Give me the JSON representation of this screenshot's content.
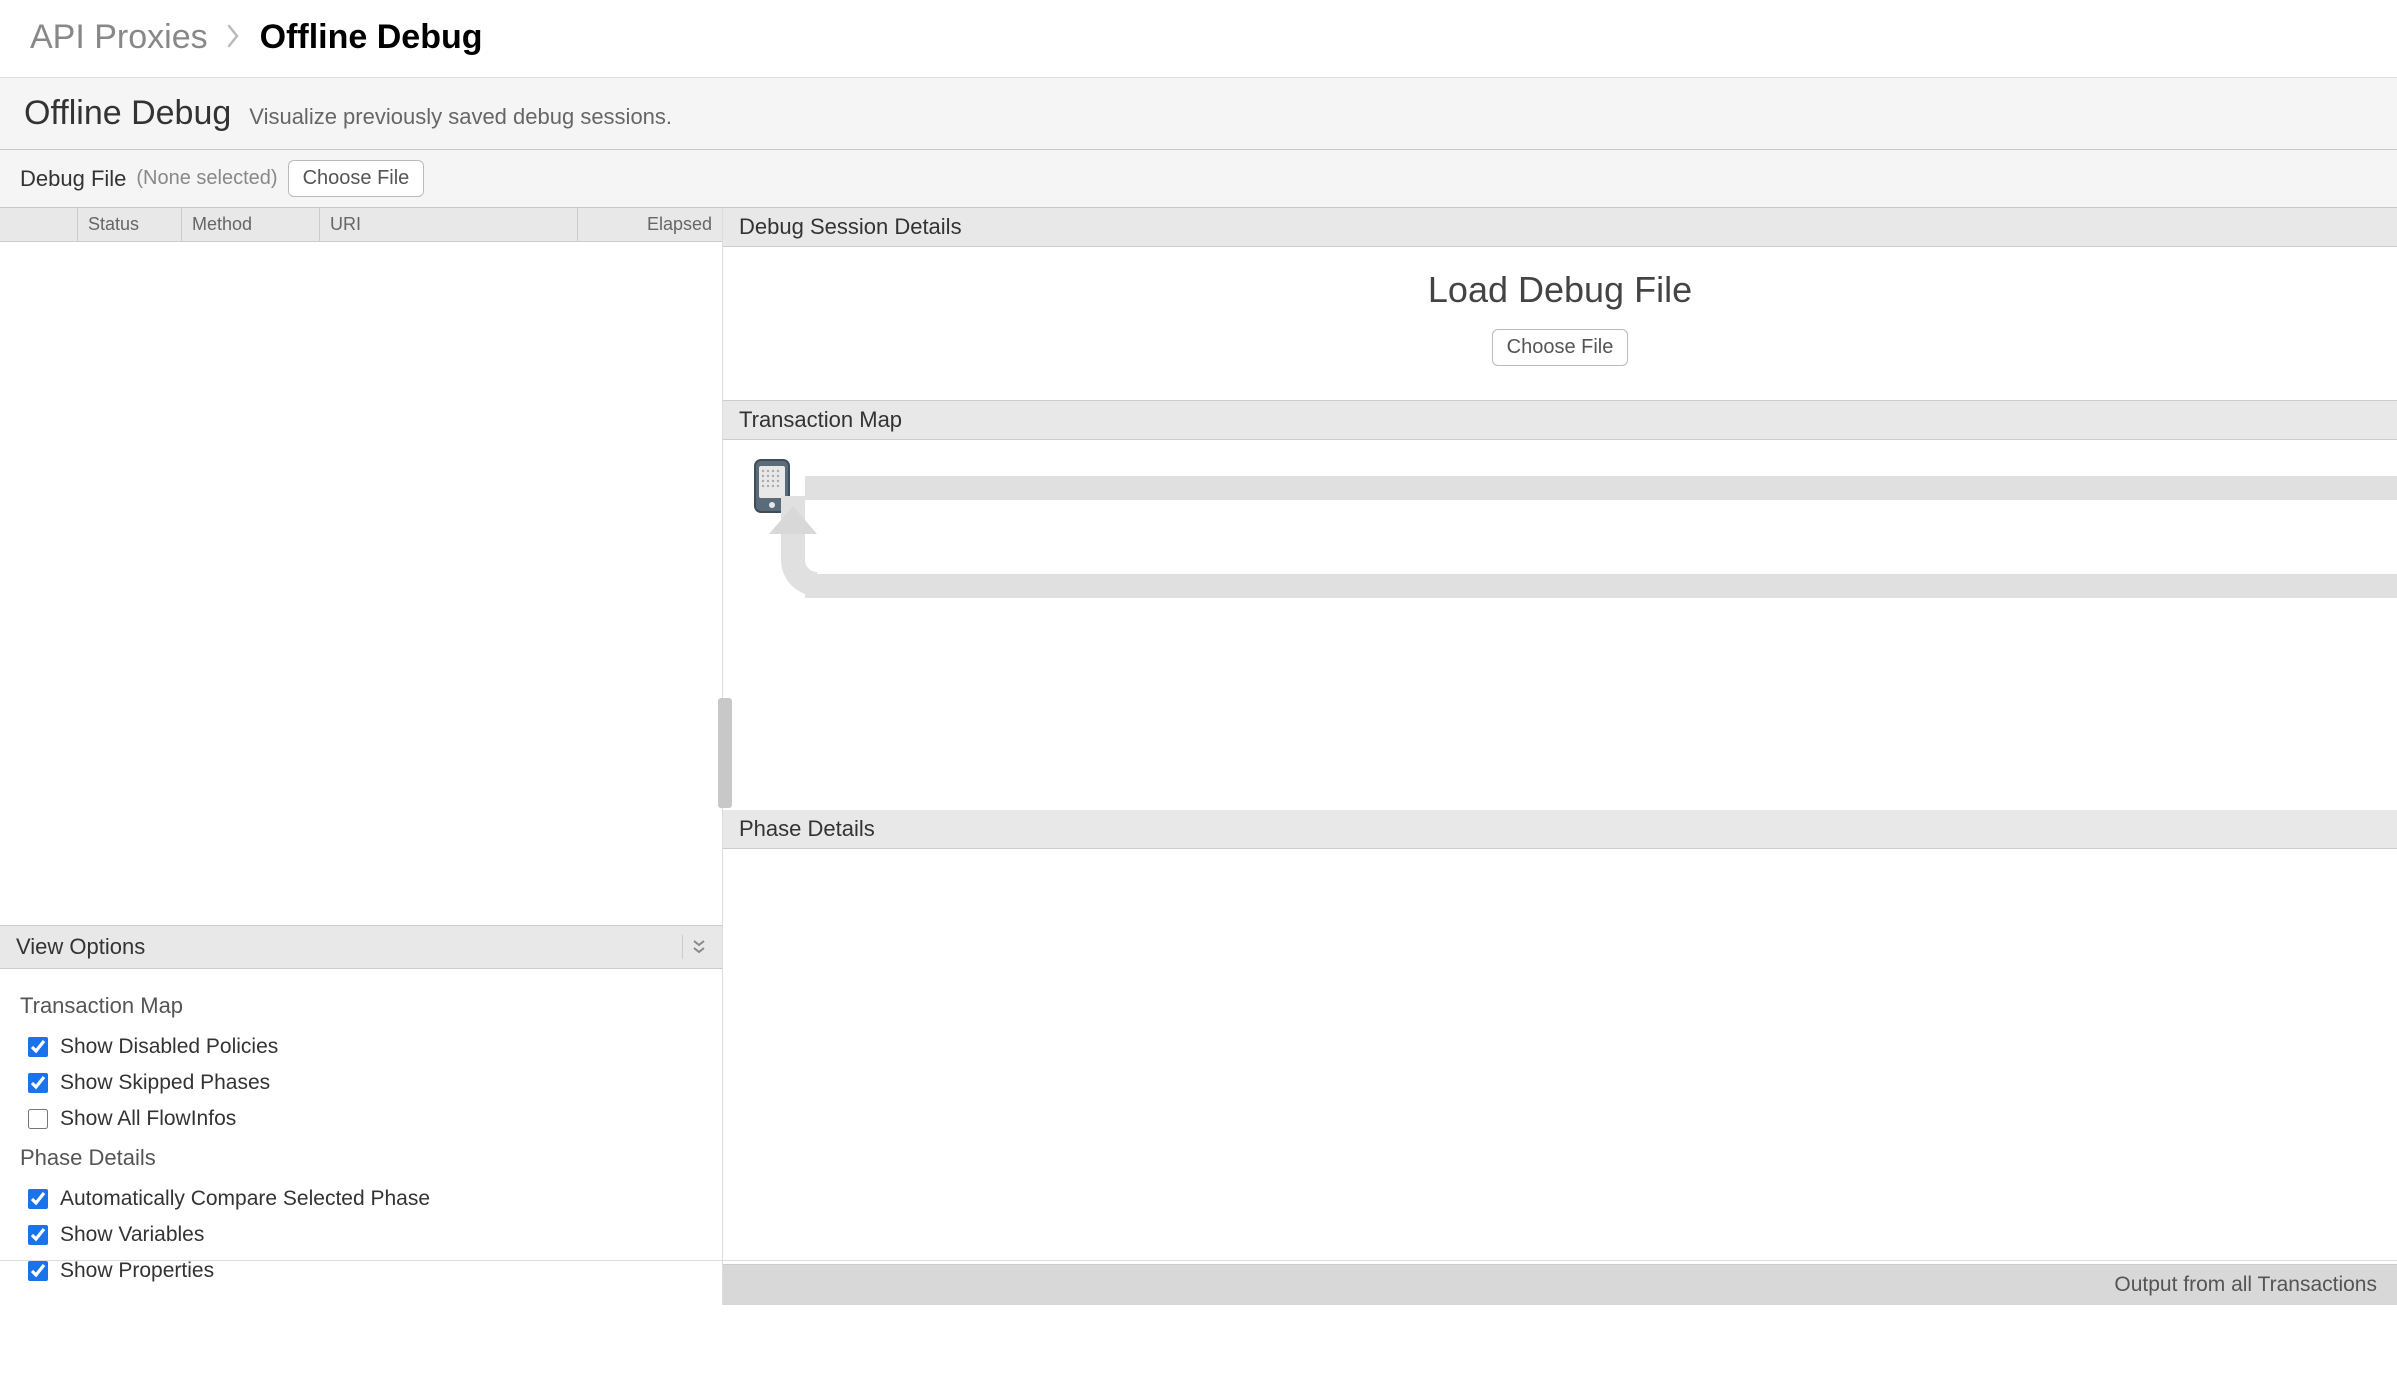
{
  "breadcrumb": {
    "parent": "API Proxies",
    "current": "Offline Debug"
  },
  "header": {
    "title": "Offline Debug",
    "subtitle": "Visualize previously saved debug sessions."
  },
  "debug_file": {
    "label": "Debug File",
    "none_selected": "(None selected)",
    "choose_button": "Choose File"
  },
  "table": {
    "columns": [
      "Status",
      "Method",
      "URI",
      "Elapsed"
    ]
  },
  "view_options": {
    "title": "View Options",
    "transaction_map": {
      "title": "Transaction Map",
      "options": [
        {
          "label": "Show Disabled Policies",
          "checked": true
        },
        {
          "label": "Show Skipped Phases",
          "checked": true
        },
        {
          "label": "Show All FlowInfos",
          "checked": false
        }
      ]
    },
    "phase_details": {
      "title": "Phase Details",
      "options": [
        {
          "label": "Automatically Compare Selected Phase",
          "checked": true
        },
        {
          "label": "Show Variables",
          "checked": true
        },
        {
          "label": "Show Properties",
          "checked": true
        }
      ]
    }
  },
  "right": {
    "debug_session": {
      "header": "Debug Session Details",
      "load_title": "Load Debug File",
      "choose_button": "Choose File"
    },
    "transaction_map": {
      "header": "Transaction Map"
    },
    "phase_details": {
      "header": "Phase Details"
    }
  },
  "footer": {
    "output_label": "Output from all Transactions"
  }
}
